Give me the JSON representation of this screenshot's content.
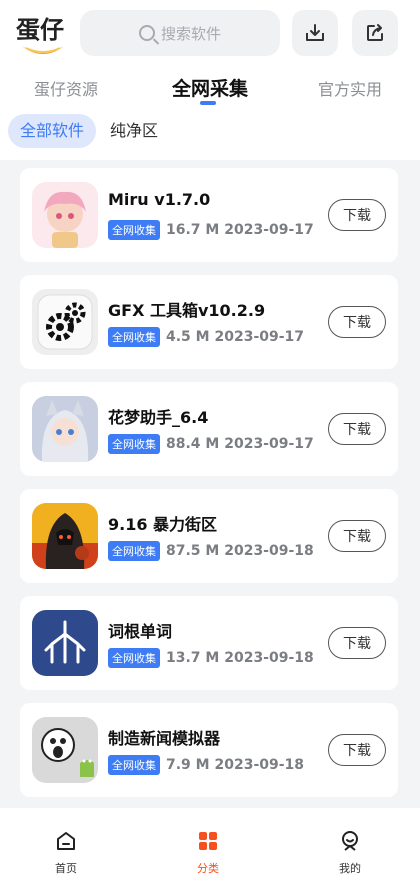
{
  "header": {
    "logo_text": "蛋仔",
    "search_placeholder": "搜索软件",
    "icons": {
      "download": "download-tray-icon",
      "share": "share-icon"
    }
  },
  "tabs": [
    {
      "label": "蛋仔资源",
      "active": false
    },
    {
      "label": "全网采集",
      "active": true
    },
    {
      "label": "官方实用",
      "active": false
    }
  ],
  "chips": [
    {
      "label": "全部软件",
      "active": true
    },
    {
      "label": "纯净区",
      "active": false
    }
  ],
  "colors": {
    "accent": "#3d7cf4",
    "active_nav": "#f4511e",
    "background": "#f3f4f6"
  },
  "apps": [
    {
      "name": "Miru v1.7.0",
      "badge": "全网收集",
      "meta": "16.7 M 2023-09-17",
      "download": "下载",
      "icon": "anime-girl-icon"
    },
    {
      "name": "GFX 工具箱v10.2.9",
      "badge": "全网收集",
      "meta": "4.5 M 2023-09-17",
      "download": "下载",
      "icon": "gears-icon"
    },
    {
      "name": "花梦助手_6.4",
      "badge": "全网收集",
      "meta": "88.4 M 2023-09-17",
      "download": "下载",
      "icon": "anime-catgirl-icon"
    },
    {
      "name": "9.16 暴力街区",
      "badge": "全网收集",
      "meta": "87.5 M 2023-09-18",
      "download": "下载",
      "icon": "hooded-fighter-icon"
    },
    {
      "name": "词根单词",
      "badge": "全网收集",
      "meta": "13.7 M 2023-09-18",
      "download": "下载",
      "icon": "word-tree-icon"
    },
    {
      "name": "制造新闻模拟器",
      "badge": "全网收集",
      "meta": "7.9 M 2023-09-18",
      "download": "下载",
      "icon": "meme-face-android-icon"
    }
  ],
  "bottom_nav": [
    {
      "label": "首页",
      "icon": "home-icon",
      "active": false
    },
    {
      "label": "分类",
      "icon": "category-grid-icon",
      "active": true
    },
    {
      "label": "我的",
      "icon": "profile-icon",
      "active": false
    }
  ]
}
